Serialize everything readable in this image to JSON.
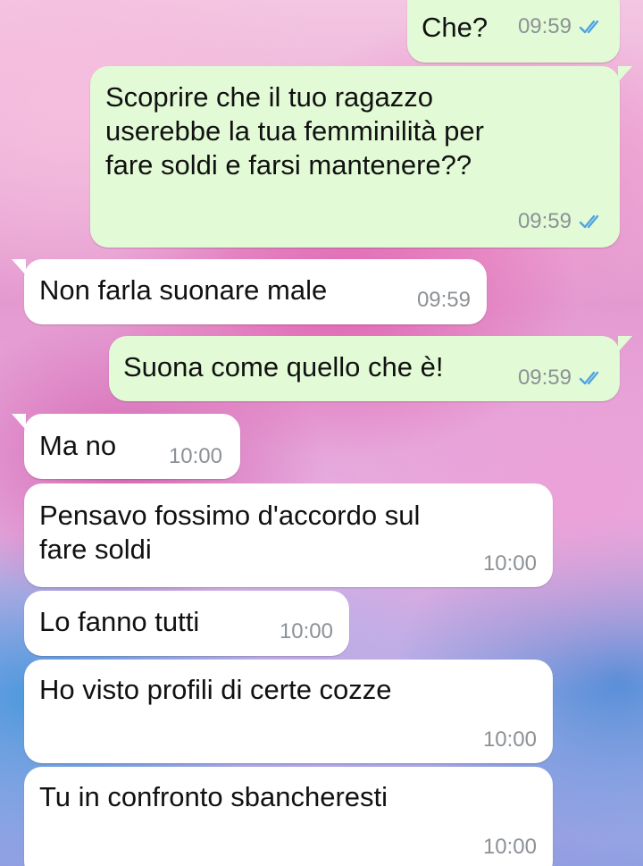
{
  "colors": {
    "outgoing_bubble": "#e2fbd6",
    "incoming_bubble": "#ffffff",
    "timestamp": "#8c9196",
    "read_ticks": "#4fa3e0"
  },
  "messages": [
    {
      "id": "m1",
      "direction": "outgoing",
      "text": "Che?",
      "time": "09:59",
      "status_icon": "double-check-read-icon"
    },
    {
      "id": "m2",
      "direction": "outgoing",
      "text": "Scoprire che il tuo ragazzo\nuserebbe la tua femminilità per\nfare soldi e farsi mantenere??",
      "time": "09:59",
      "status_icon": "double-check-read-icon"
    },
    {
      "id": "m3",
      "direction": "incoming",
      "text": "Non farla suonare male",
      "time": "09:59"
    },
    {
      "id": "m4",
      "direction": "outgoing",
      "text": "Suona come quello che è!",
      "time": "09:59",
      "status_icon": "double-check-read-icon"
    },
    {
      "id": "m5",
      "direction": "incoming",
      "text": "Ma no",
      "time": "10:00"
    },
    {
      "id": "m6",
      "direction": "incoming",
      "text": "Pensavo fossimo d'accordo sul\nfare soldi",
      "time": "10:00"
    },
    {
      "id": "m7",
      "direction": "incoming",
      "text": "Lo fanno tutti",
      "time": "10:00"
    },
    {
      "id": "m8",
      "direction": "incoming",
      "text": "Ho visto profili di certe cozze",
      "time": "10:00"
    },
    {
      "id": "m9",
      "direction": "incoming",
      "text": "Tu in confronto sbancheresti",
      "time": "10:00"
    }
  ]
}
